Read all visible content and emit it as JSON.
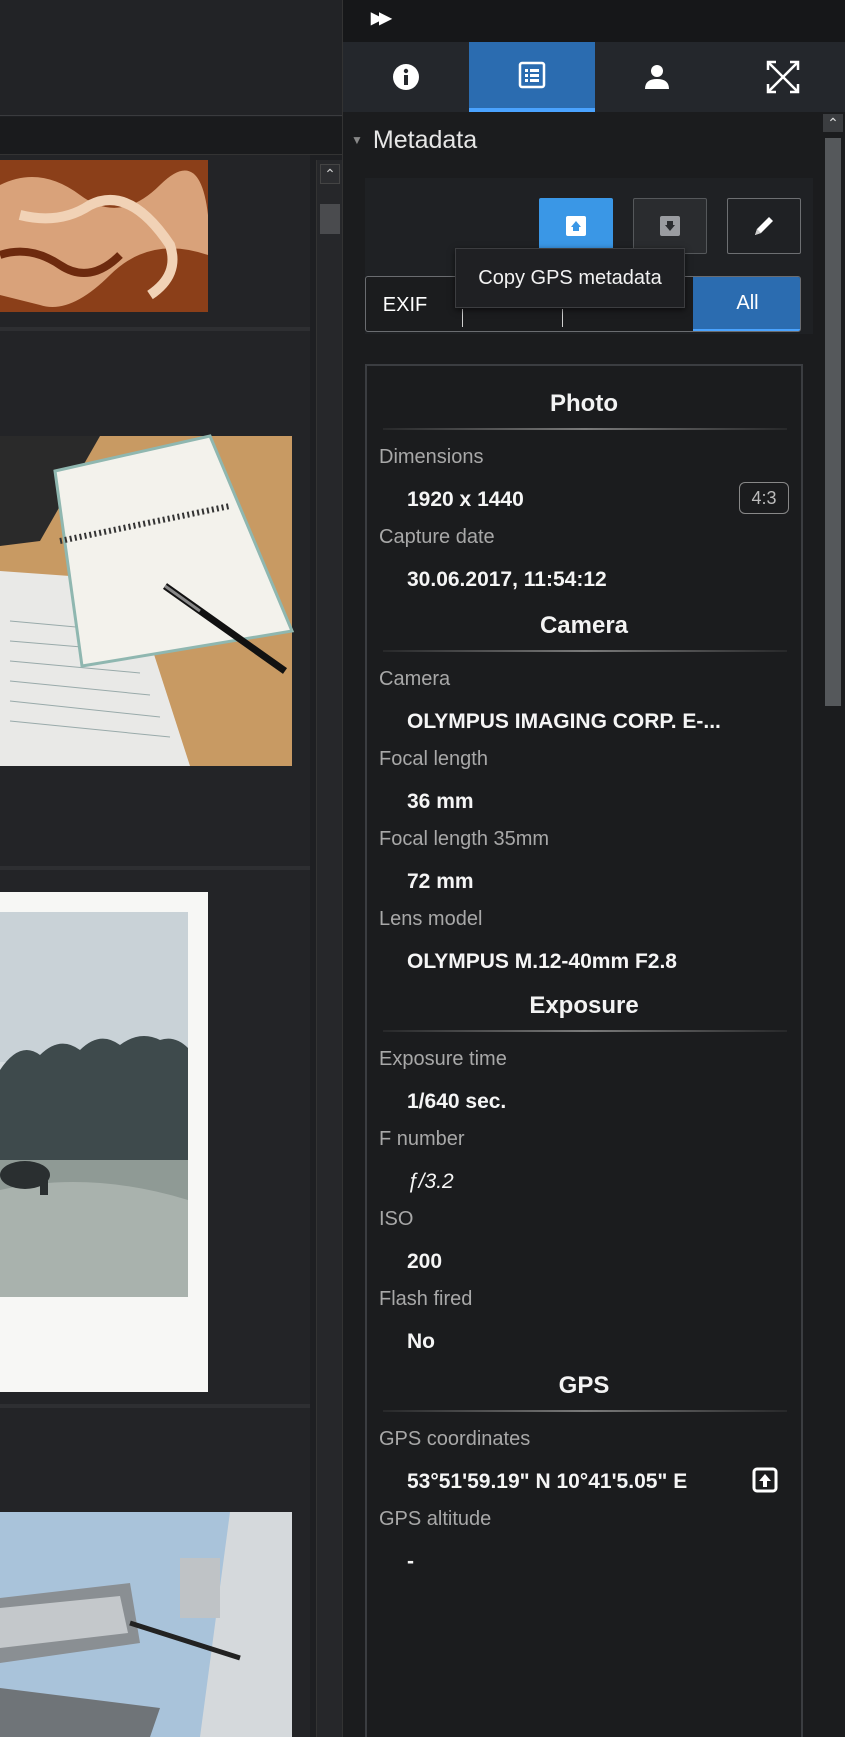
{
  "panel": {
    "collapse_icon": "fast-forward-icon",
    "tabs": [
      {
        "icon": "info-icon",
        "active": false
      },
      {
        "icon": "metadata-list-icon",
        "active": true
      },
      {
        "icon": "person-icon",
        "active": false
      },
      {
        "icon": "expand-diagonal-icon",
        "active": false
      }
    ],
    "section_title": "Metadata"
  },
  "actions": {
    "copy_gps_icon": "upload-box-icon",
    "paste_gps_icon": "download-box-icon",
    "edit_icon": "pencil-icon",
    "tooltip": "Copy GPS metadata"
  },
  "filter": {
    "exif": "EXIF",
    "all": "All"
  },
  "metadata": {
    "photo": {
      "title": "Photo",
      "dimensions_label": "Dimensions",
      "dimensions_value": "1920 x 1440",
      "ratio": "4:3",
      "capture_label": "Capture date",
      "capture_value": "30.06.2017, 11:54:12"
    },
    "camera": {
      "title": "Camera",
      "camera_label": "Camera",
      "camera_value": "OLYMPUS IMAGING CORP. E-...",
      "focal_label": "Focal length",
      "focal_value": "36 mm",
      "focal35_label": "Focal length 35mm",
      "focal35_value": "72 mm",
      "lens_label": "Lens model",
      "lens_value": "OLYMPUS M.12-40mm F2.8"
    },
    "exposure": {
      "title": "Exposure",
      "time_label": "Exposure time",
      "time_value": "1/640 sec.",
      "fnum_label": "F number",
      "fnum_value": "ƒ/3.2",
      "iso_label": "ISO",
      "iso_value": "200",
      "flash_label": "Flash fired",
      "flash_value": "No"
    },
    "gps": {
      "title": "GPS",
      "coords_label": "GPS coordinates",
      "coords_value": "53°51'59.19\" N 10°41'5.05\" E",
      "alt_label": "GPS altitude",
      "alt_value": "-"
    }
  },
  "colors": {
    "accent": "#3a97e6",
    "active_tab": "#2b6cb0"
  }
}
